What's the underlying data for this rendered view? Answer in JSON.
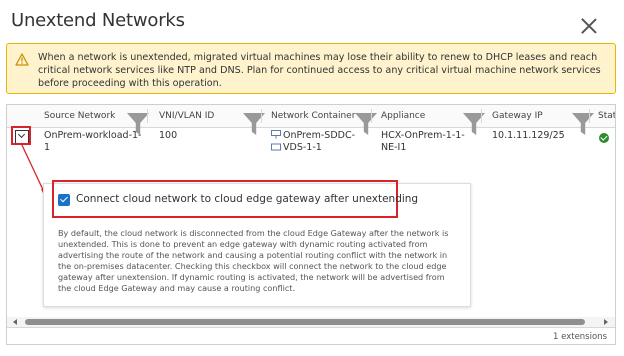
{
  "dialog": {
    "title": "Unextend Networks",
    "close_icon": "close-icon"
  },
  "alert": {
    "icon": "warning-icon",
    "text": "When a network is unextended, migrated virtual machines may lose their ability to renew to DHCP leases and reach critical network services like NTP and DNS. Plan for continued access to any critical virtual machine network services before proceeding with this operation."
  },
  "grid": {
    "columns": [
      {
        "label": "Source Network"
      },
      {
        "label": "VNI/VLAN ID"
      },
      {
        "label": "Network Container"
      },
      {
        "label": "Appliance"
      },
      {
        "label": "Gateway IP"
      },
      {
        "label": "Statu"
      }
    ],
    "rows": [
      {
        "source_network_l1": "OnPrem-workload-1-",
        "source_network_l2": "1",
        "vni_vlan_id": "100",
        "network_container_l1": "OnPrem-SDDC-",
        "network_container_l2": "VDS-1-1",
        "appliance_l1": "HCX-OnPrem-1-1-",
        "appliance_l2": "NE-I1",
        "gateway_ip": "10.1.11.129/25",
        "status_icon": "check-circle-icon"
      }
    ],
    "detail": {
      "checkbox_label": "Connect cloud network to cloud edge gateway after unextending",
      "checked": true,
      "description": "By default, the cloud network is disconnected from the cloud Edge Gateway after the network is unextended. This is done to prevent an edge gateway with dynamic routing activated from advertising the route of the network and causing a potential routing conflict with the network in the on-premises datacenter. Checking this checkbox will connect the network to the cloud edge gateway after unextension. If dynamic routing is activated, the network will be advertised from the cloud Edge Gateway and may cause a routing conflict."
    },
    "footer": "1 extensions"
  },
  "colors": {
    "alert_bg": "#fef3cd",
    "alert_border": "#e6b800",
    "highlight": "#d9232a",
    "checkbox": "#1a73c8",
    "status_ok": "#2e8b2e"
  }
}
